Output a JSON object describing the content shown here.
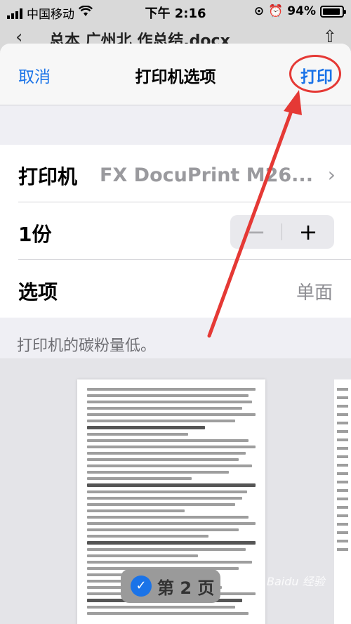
{
  "status_bar": {
    "carrier": "中国移动",
    "time": "下午 2:16",
    "battery": "94%",
    "battery_level": 0.94
  },
  "background_doc": {
    "title": "总本 广州北   作总结.docx"
  },
  "nav": {
    "cancel": "取消",
    "title": "打印机选项",
    "print": "打印"
  },
  "printer": {
    "label": "打印机",
    "value": "FX DocuPrint M26..."
  },
  "copies": {
    "label": "1份",
    "minus": "−",
    "plus": "+"
  },
  "options": {
    "label": "选项",
    "value": "单面"
  },
  "warning": "打印机的碳粉量低。",
  "preview": {
    "page_badge": "第 2 页"
  },
  "watermark": "Baidu 经验",
  "colors": {
    "accent": "#1a73e8",
    "annotation": "#e53935"
  }
}
